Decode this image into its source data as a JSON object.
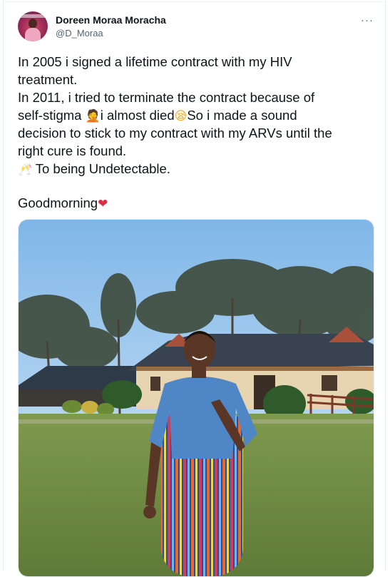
{
  "tweet": {
    "author": {
      "name": "Doreen Moraa Moracha",
      "handle": "@D_Moraa"
    },
    "more_label": "···",
    "lines": [
      "In 2005 i signed a lifetime contract with my HIV",
      "treatment.",
      "In 2011, i tried to terminate the contract because of",
      "self-stigma ",
      "i almost died",
      "So i made a sound",
      "decision to stick to my contract with my ARVs until the",
      "right cure is found.",
      " To being Undetectable.",
      "Goodmorning"
    ],
    "emojis": {
      "facepalm": "🤦",
      "face": "😪",
      "cheers": "🥂",
      "heart": "❤"
    },
    "media": {
      "description_icon": "photo"
    }
  },
  "colors": {
    "text": "#0f1419",
    "secondary": "#536471",
    "heart": "#dd2e44",
    "border": "#e6ecf0"
  }
}
